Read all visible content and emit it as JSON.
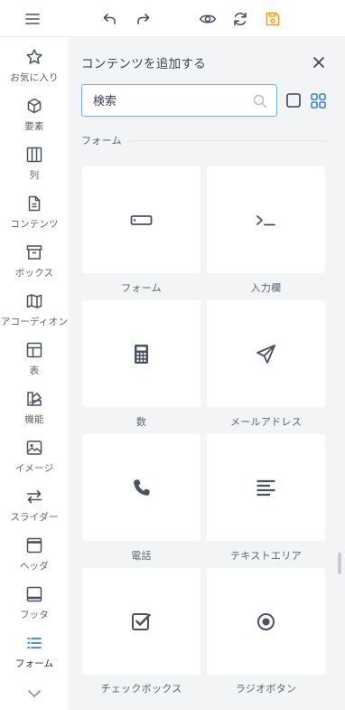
{
  "toolbar": {
    "menu": "hamburger-menu-icon",
    "undo": "undo-icon",
    "redo": "redo-icon",
    "preview": "eye-icon",
    "refresh": "refresh-icon",
    "save": "save-icon",
    "save_color": "#f0a010"
  },
  "sidebar": {
    "items": [
      {
        "label": "お気に入り",
        "icon": "star-icon"
      },
      {
        "label": "要素",
        "icon": "cube-icon"
      },
      {
        "label": "列",
        "icon": "columns-icon"
      },
      {
        "label": "コンテンツ",
        "icon": "document-icon"
      },
      {
        "label": "ボックス",
        "icon": "archive-box-icon"
      },
      {
        "label": "アコーディオン",
        "icon": "map-fold-icon"
      },
      {
        "label": "表",
        "icon": "table-icon"
      },
      {
        "label": "機能",
        "icon": "shapes-icon"
      },
      {
        "label": "イメージ",
        "icon": "image-icon"
      },
      {
        "label": "スライダー",
        "icon": "slider-arrows-icon"
      },
      {
        "label": "ヘッダ",
        "icon": "header-icon"
      },
      {
        "label": "フッタ",
        "icon": "footer-icon"
      },
      {
        "label": "フォーム",
        "icon": "list-icon"
      }
    ],
    "active_color": "#3d7fd6",
    "more": "chevron-down-icon"
  },
  "panel": {
    "title": "コンテンツを追加する",
    "close": "close-icon",
    "search": {
      "value": "",
      "placeholder": "検索"
    },
    "section": "フォーム",
    "cards": [
      {
        "label": "フォーム",
        "icon": "form-field-icon"
      },
      {
        "label": "入力欄",
        "icon": "prompt-icon"
      },
      {
        "label": "数",
        "icon": "calculator-icon"
      },
      {
        "label": "メールアドレス",
        "icon": "paper-plane-icon"
      },
      {
        "label": "電話",
        "icon": "phone-icon"
      },
      {
        "label": "テキストエリア",
        "icon": "align-left-icon"
      },
      {
        "label": "チェックボックス",
        "icon": "checkbox-icon"
      },
      {
        "label": "ラジオボタン",
        "icon": "radio-icon"
      }
    ]
  }
}
